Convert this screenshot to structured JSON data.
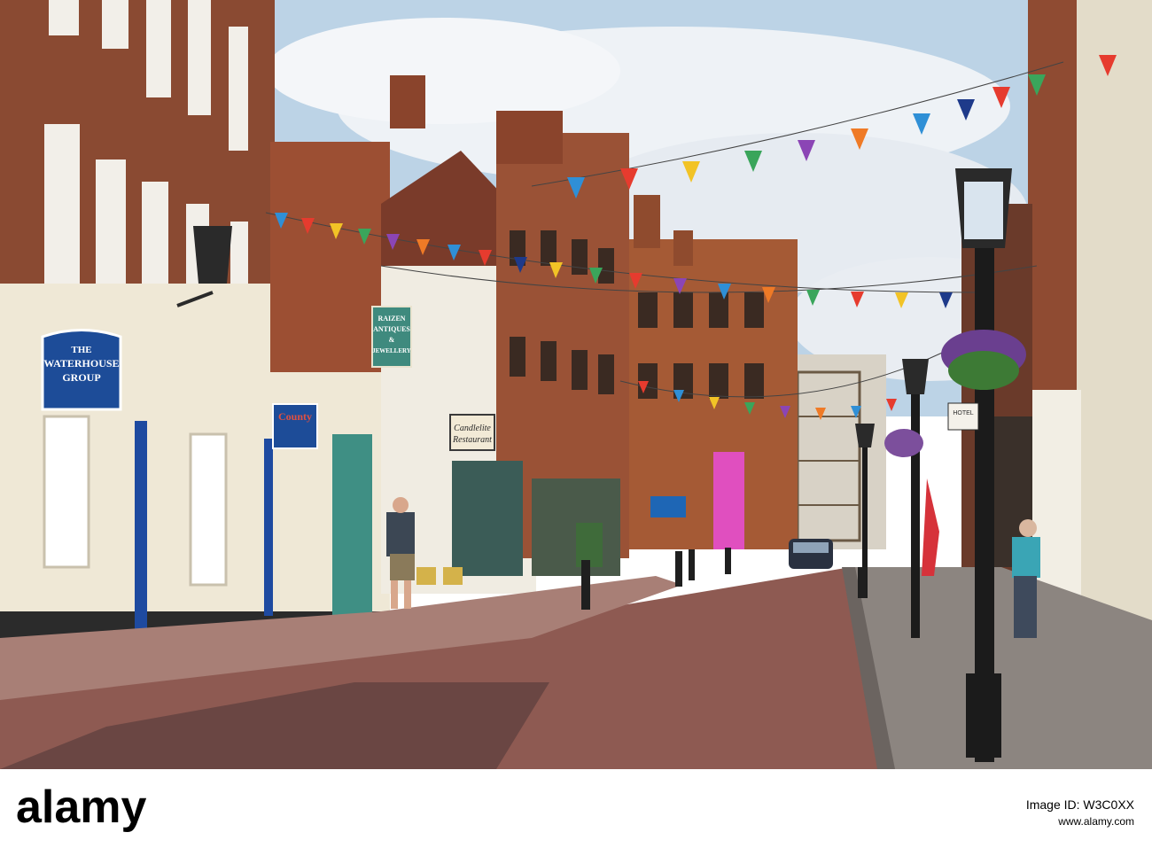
{
  "signs": {
    "waterhouse_line1": "THE",
    "waterhouse_line2": "WATERHOUSE",
    "waterhouse_line3": "GROUP",
    "antiques_line1": "RAIZEN",
    "antiques_line2": "ANTIQUES",
    "antiques_line3": "&",
    "antiques_line4": "JEWELLERY",
    "candlelite_line1": "Candlelite",
    "candlelite_line2": "Restaurant",
    "county_line1": "County",
    "hotel": "HOTEL"
  },
  "watermark": {
    "brand": "alamy",
    "image_id": "Image ID: W3C0XX",
    "url": "www.alamy.com"
  },
  "colors": {
    "sky": "#b8cfe2",
    "brick": "#8a4a32",
    "cream": "#efe8d6",
    "road": "#8e5a52",
    "sign_blue": "#1d4c98"
  }
}
